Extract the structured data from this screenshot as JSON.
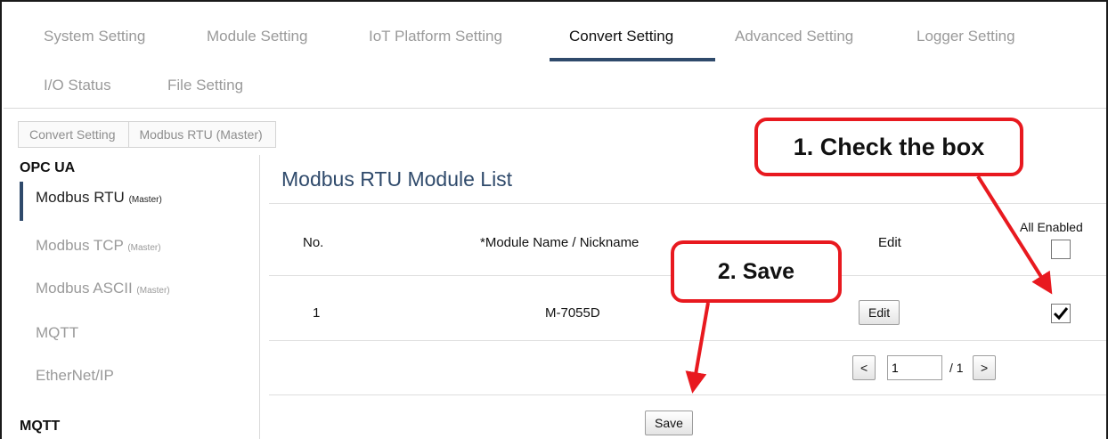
{
  "nav": {
    "tabs": [
      "System Setting",
      "Module Setting",
      "IoT Platform Setting",
      "Convert Setting",
      "Advanced Setting",
      "Logger Setting",
      "I/O Status",
      "File Setting"
    ],
    "active": "Convert Setting"
  },
  "breadcrumb": [
    "Convert Setting",
    "Modbus RTU (Master)"
  ],
  "sidebar": {
    "section1": "OPC UA",
    "items": [
      {
        "label": "Modbus RTU",
        "tag": "(Master)"
      },
      {
        "label": "Modbus TCP",
        "tag": "(Master)"
      },
      {
        "label": "Modbus ASCII",
        "tag": "(Master)"
      },
      {
        "label": "MQTT",
        "tag": ""
      },
      {
        "label": "EtherNet/IP",
        "tag": ""
      }
    ],
    "section2": "MQTT"
  },
  "main": {
    "title": "Modbus RTU Module List",
    "headers": {
      "no": "No.",
      "name": "*Module Name / Nickname",
      "edit": "Edit",
      "enabled": "All Enabled"
    },
    "rows": [
      {
        "no": "1",
        "name": "M-7055D",
        "edit_label": "Edit",
        "enabled": true
      }
    ],
    "pagination": {
      "prev": "<",
      "page": "1",
      "total": "/ 1",
      "next": ">"
    },
    "save_label": "Save"
  },
  "annotations": {
    "step1": "1. Check the box",
    "step2": "2. Save",
    "color": "#e8191f"
  },
  "colors": {
    "accent": "#2f4a6b",
    "annotation": "#e8191f"
  }
}
